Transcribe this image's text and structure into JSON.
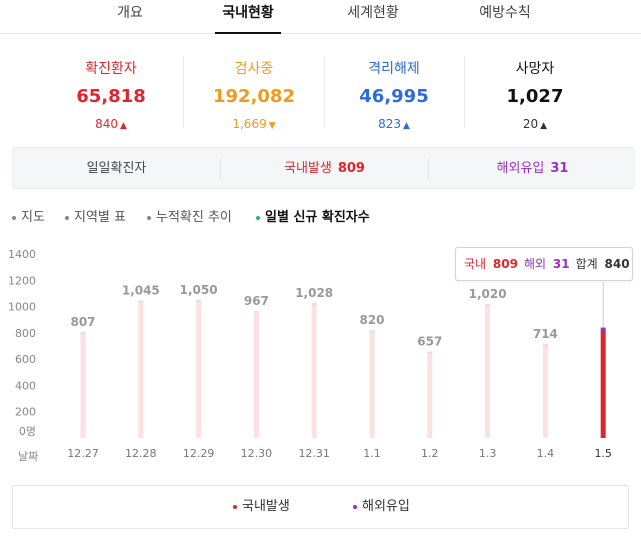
{
  "tabs": [
    {
      "label": "개요",
      "active": false
    },
    {
      "label": "국내현황",
      "active": true
    },
    {
      "label": "세계현황",
      "active": false
    },
    {
      "label": "예방수칙",
      "active": false
    }
  ],
  "stats": [
    {
      "label": "확진환자",
      "value": "65,818",
      "delta": "840",
      "direction": "up",
      "color": "#e0262c"
    },
    {
      "label": "검사중",
      "value": "192,082",
      "delta": "1,669",
      "direction": "down",
      "color": "#f39a1d"
    },
    {
      "label": "격리해제",
      "value": "46,995",
      "delta": "823",
      "direction": "up",
      "color": "#2e6bd9"
    },
    {
      "label": "사망자",
      "value": "1,027",
      "delta": "20",
      "direction": "up",
      "color": "#111111"
    }
  ],
  "daily": {
    "label": "일일확진자",
    "local_label": "국내발생",
    "local_value": "809",
    "overseas_label": "해외유입",
    "overseas_value": "31"
  },
  "chart_options": [
    "지도",
    "지역별 표",
    "누적확진 추이",
    "일별 신규 확진자수"
  ],
  "tooltip": {
    "local_label": "국내",
    "local_value": "809",
    "overseas_label": "해외",
    "overseas_value": "31",
    "total_label": "합계",
    "total_value": "840"
  },
  "colors": {
    "local": "#e0262c",
    "overseas": "#9b2fc4",
    "bar_faint": "#fde0e0",
    "axis_text": "#888888",
    "value_text": "#999999"
  },
  "chart_data": {
    "type": "bar",
    "stacked": true,
    "categories": [
      "12.27",
      "12.28",
      "12.29",
      "12.30",
      "12.31",
      "1.1",
      "1.2",
      "1.3",
      "1.4",
      "1.5"
    ],
    "totals": [
      807,
      1045,
      1050,
      967,
      1028,
      820,
      657,
      1020,
      714,
      840
    ],
    "total_labels": [
      "807",
      "1,045",
      "1,050",
      "967",
      "1,028",
      "820",
      "657",
      "1,020",
      "714",
      ""
    ],
    "series": [
      {
        "name": "국내발생",
        "values": [
          null,
          null,
          null,
          null,
          null,
          null,
          null,
          null,
          null,
          809
        ]
      },
      {
        "name": "해외유입",
        "values": [
          null,
          null,
          null,
          null,
          null,
          null,
          null,
          null,
          null,
          31
        ]
      }
    ],
    "highlight_index": 9,
    "yticks": [
      "0명",
      "200",
      "400",
      "600",
      "800",
      "1000",
      "1200",
      "1400"
    ],
    "ylim": [
      0,
      1400
    ],
    "xlabel": "날짜",
    "legend_position": "bottom",
    "legend": [
      "국내발생",
      "해외유입"
    ]
  }
}
